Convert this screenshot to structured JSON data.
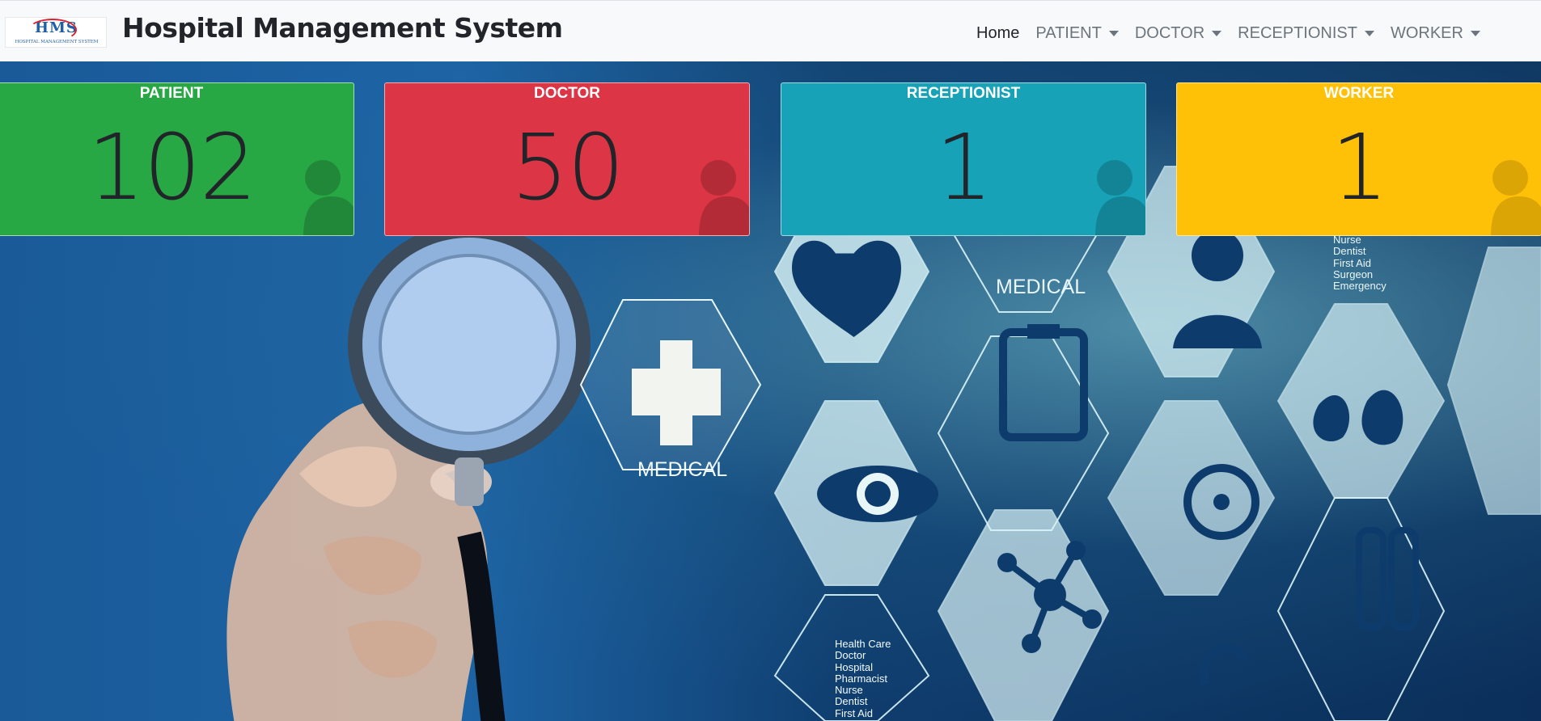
{
  "navbar": {
    "logo_mark": "HMS",
    "logo_subtitle": "HOSPITAL MANAGEMENT SYSTEM",
    "title": "Hospital Management System",
    "items": [
      {
        "label": "Home",
        "dropdown": false,
        "active": true
      },
      {
        "label": "PATIENT",
        "dropdown": true,
        "active": false
      },
      {
        "label": "DOCTOR",
        "dropdown": true,
        "active": false
      },
      {
        "label": "RECEPTIONIST",
        "dropdown": true,
        "active": false
      },
      {
        "label": "WORKER",
        "dropdown": true,
        "active": false
      }
    ]
  },
  "stats": [
    {
      "title": "PATIENT",
      "value": "102",
      "color": "#28a745"
    },
    {
      "title": "DOCTOR",
      "value": "50",
      "color": "#dc3545"
    },
    {
      "title": "RECEPTIONIST",
      "value": "1",
      "color": "#17a2b8"
    },
    {
      "title": "WORKER",
      "value": "1",
      "color": "#ffc107"
    }
  ],
  "hero": {
    "medical_label_1": "MEDICAL",
    "medical_label_2": "MEDICAL",
    "list_top": [
      "Nurse",
      "Dentist",
      "First Aid",
      "Surgeon",
      "Emergency"
    ],
    "list_bottom": [
      "Health Care",
      "Doctor",
      "Hospital",
      "Pharmacist",
      "Nurse",
      "Dentist",
      "First Aid"
    ]
  }
}
